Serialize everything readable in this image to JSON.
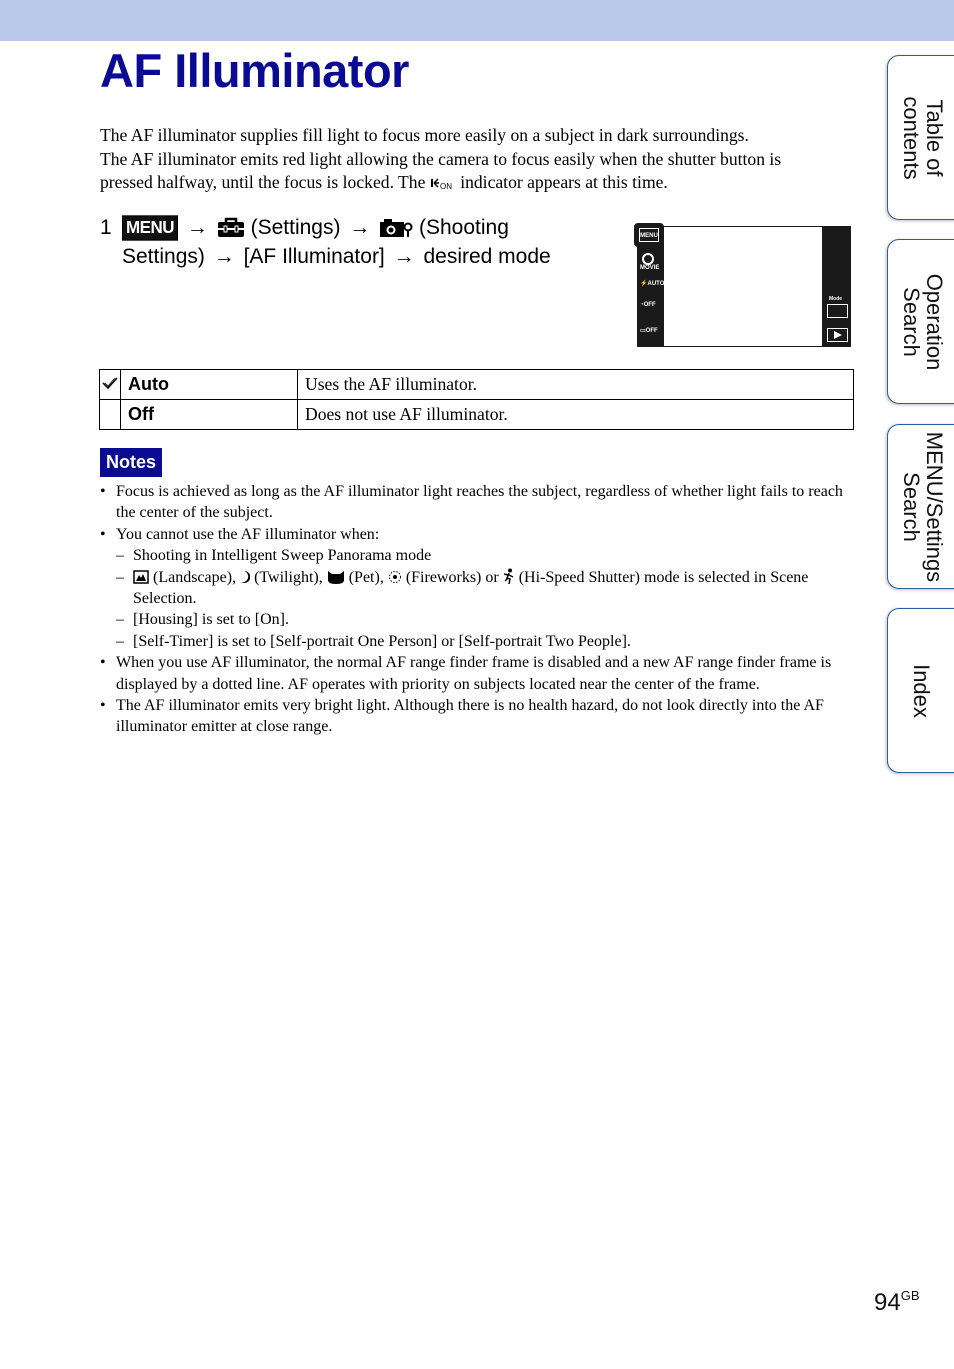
{
  "page": {
    "title": "AF Illuminator",
    "intro": {
      "line1": "The AF illuminator supplies fill light to focus more easily on a subject in dark surroundings.",
      "line2": "The AF illuminator emits red light allowing the camera to focus easily when the shutter button is",
      "line3_before": "pressed halfway, until the focus is locked. The ",
      "indicator_icon": "af-illuminator-on-icon",
      "indicator_text": "ON",
      "line3_after": " indicator appears at this time."
    },
    "step": {
      "number": "1",
      "menu_label": "MENU",
      "arrow": "→",
      "settings_label": "(Settings)",
      "shooting_label_a": "(Shooting",
      "shooting_label_b": "Settings)",
      "af_item": "[AF Illuminator]",
      "desired": "desired mode"
    },
    "screen": {
      "menu_label": "MENU",
      "left_icons": [
        "MOVIE",
        "AUTO",
        "OFF",
        "OFF"
      ],
      "mode_label": "Mode",
      "playback_icon": "play-icon"
    },
    "modes_table": [
      {
        "checked": true,
        "name": "Auto",
        "description": "Uses the AF illuminator."
      },
      {
        "checked": false,
        "name": "Off",
        "description": "Does not use AF illuminator."
      }
    ],
    "notes": {
      "label": "Notes",
      "bullet": "•",
      "dash": "–",
      "n1": "Focus is achieved as long as the AF illuminator light reaches the subject, regardless of whether light fails to reach the center of the subject.",
      "n2": "You cannot use the AF illuminator when:",
      "n2_sub1": "Shooting in Intelligent Sweep Panorama mode",
      "n2_sub2": {
        "landscape": "(Landscape),",
        "twilight": "(Twilight),",
        "pet": "(Pet),",
        "fireworks": "(Fireworks) or",
        "hispeed": "(Hi-Speed Shutter) mode is selected in Scene Selection."
      },
      "n2_sub3": "[Housing] is set to [On].",
      "n2_sub4": "[Self-Timer] is set to [Self-portrait One Person] or [Self-portrait Two People].",
      "n3": "When you use AF illuminator, the normal AF range finder frame is disabled and a new AF range finder frame is displayed by a dotted line. AF operates with priority on subjects located near the center of the frame.",
      "n4": "The AF illuminator emits very bright light. Although there is no health hazard, do not look directly into the AF illuminator emitter at close range."
    },
    "side_tabs": [
      {
        "label": "Table of contents"
      },
      {
        "label": "Operation Search"
      },
      {
        "label": "MENU/Settings Search"
      },
      {
        "label": "Index"
      }
    ],
    "page_number": "94",
    "page_suffix": "GB",
    "colors": {
      "title": "#0b0a93",
      "band": "#b8c7ea",
      "notes_bg": "#0b0a93",
      "tab_border": "#2c5d96"
    }
  }
}
